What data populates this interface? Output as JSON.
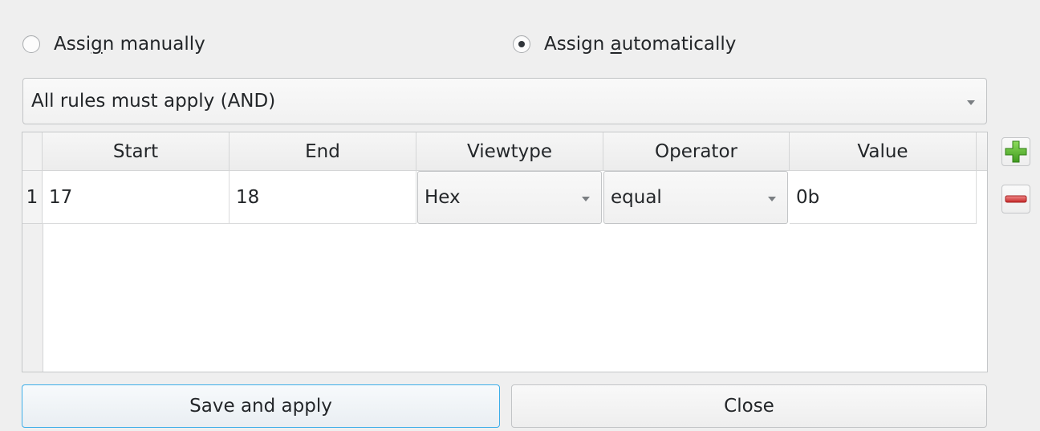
{
  "assignment": {
    "manual": {
      "prefix": "Assi",
      "mnemonic": "g",
      "suffix": "n manually",
      "checked": false
    },
    "automatic": {
      "prefix": "Assign ",
      "mnemonic": "a",
      "suffix": "utomatically",
      "checked": true
    }
  },
  "rule_mode": {
    "selected": "All rules must apply (AND)"
  },
  "table": {
    "columns": [
      "Start",
      "End",
      "Viewtype",
      "Operator",
      "Value"
    ],
    "rows": [
      {
        "index": "1",
        "start": "17",
        "end": "18",
        "viewtype": "Hex",
        "operator": "equal",
        "value": "0b"
      }
    ]
  },
  "side_buttons": {
    "add_icon": "plus-icon",
    "remove_icon": "minus-icon",
    "add_color": "#4caf2a",
    "remove_color": "#da4453"
  },
  "buttons": {
    "save": "Save and apply",
    "close": "Close"
  },
  "colors": {
    "focus": "#3daee9"
  }
}
